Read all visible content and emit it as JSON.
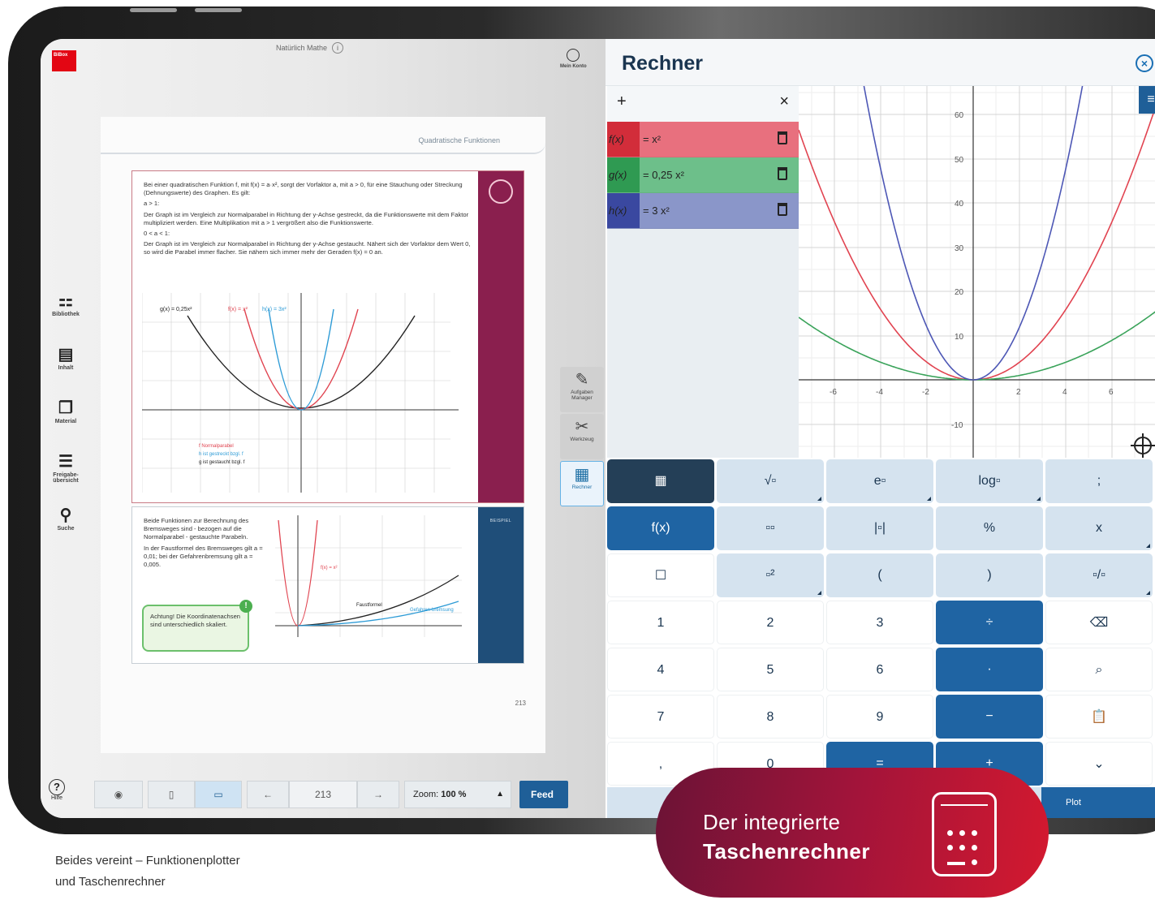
{
  "reader": {
    "book_title": "Natürlich Mathe",
    "account_label": "Mein Konto",
    "logo_text": "BiBox",
    "nav": [
      {
        "label": "Bibliothek",
        "icon": "library-icon"
      },
      {
        "label": "Inhalt",
        "icon": "contents-icon"
      },
      {
        "label": "Material",
        "icon": "material-icon"
      },
      {
        "label": "Freigabe-übersicht",
        "icon": "share-overview-icon"
      },
      {
        "label": "Suche",
        "icon": "search-icon"
      }
    ],
    "help_label": "Hilfe",
    "page": {
      "chapter": "Quadratische Funktionen",
      "para1": "Bei einer quadratischen Funktion f, mit f(x) = a·x², sorgt der Vorfaktor a, mit a > 0, für eine Stauchung oder Streckung (Dehnungswerte) des Graphen. Es gilt:",
      "case1_head": "a > 1:",
      "case1": "Der Graph ist im Vergleich zur Normalparabel in Richtung der y-Achse gestreckt, da die Funktionswerte mit dem Faktor multipliziert werden. Eine Multiplikation mit a > 1 vergrößert also die Funktionswerte.",
      "case2_head": "0 < a < 1:",
      "case2": "Der Graph ist im Vergleich zur Normalparabel in Richtung der y-Achse gestaucht. Nähert sich der Vorfaktor dem Wert 0, so wird die Parabel immer flacher. Sie nähern sich immer mehr der Geraden f(x) = 0 an.",
      "fig1_labels": [
        "g(x) = 0,25x²",
        "f(x) = x²",
        "h(x) = 3x²"
      ],
      "fig1_legend": [
        "f Normalparabel",
        "h ist gestreckt bzgl. f",
        "g ist gestaucht bzgl. f"
      ],
      "example_band": "BEISPIEL",
      "example_p1": "Beide Funktionen zur Berechnung des Bremsweges sind - bezogen auf die Normalparabel - gestauchte Parabeln.",
      "example_p2": "In der Faustformel des Bremsweges gilt a = 0,01; bei der Gefahrenbremsung gilt a = 0,005.",
      "note": "Achtung! Die Koordinatenachsen sind unterschiedlich skaliert.",
      "fig2_labels": [
        "f(x) = x²",
        "Faustformel",
        "Gefahren-bremsung"
      ],
      "page_number": "213"
    },
    "tools": [
      {
        "label": "Aufgaben Manager",
        "icon": "task-manager-icon"
      },
      {
        "label": "Werkzeug",
        "icon": "tools-icon"
      },
      {
        "label": "Rechner",
        "icon": "calculator-icon"
      }
    ],
    "bottombar": {
      "page_input": "213",
      "zoom_label": "Zoom:",
      "zoom_value": "100 %",
      "feedback": "Feed"
    }
  },
  "calculator": {
    "title": "Rechner",
    "functions": [
      {
        "name": "f(x)",
        "expr": "= x²",
        "color": "#e8707e"
      },
      {
        "name": "g(x)",
        "expr": "= 0,25 x²",
        "color": "#6dbf8a"
      },
      {
        "name": "h(x)",
        "expr": "= 3 x²",
        "color": "#8a96c9"
      }
    ],
    "graph": {
      "x_ticks": [
        "-6",
        "-4",
        "-2",
        "2",
        "4",
        "6"
      ],
      "y_ticks": [
        "60",
        "50",
        "40",
        "30",
        "20",
        "10",
        "-10"
      ]
    },
    "keys": [
      [
        "▦",
        "√▫",
        "e▫",
        "log▫",
        ";"
      ],
      [
        "f(x)",
        "▫▫",
        "|▫|",
        "%",
        "x"
      ],
      [
        "☐",
        "▫²",
        "(",
        ")",
        "▫/▫"
      ],
      [
        "1",
        "2",
        "3",
        "÷",
        "⌫"
      ],
      [
        "4",
        "5",
        "6",
        "·",
        "⌕"
      ],
      [
        "7",
        "8",
        "9",
        "−",
        "📋"
      ],
      [
        ",",
        "0",
        "=",
        "+",
        "⌄"
      ]
    ],
    "plot_label": "Plot"
  },
  "promo": {
    "line1": "Der integrierte",
    "line2": "Taschenrechner"
  },
  "caption": {
    "line1": "Beides vereint – Funktionenplotter",
    "line2": "und Taschenrechner"
  }
}
